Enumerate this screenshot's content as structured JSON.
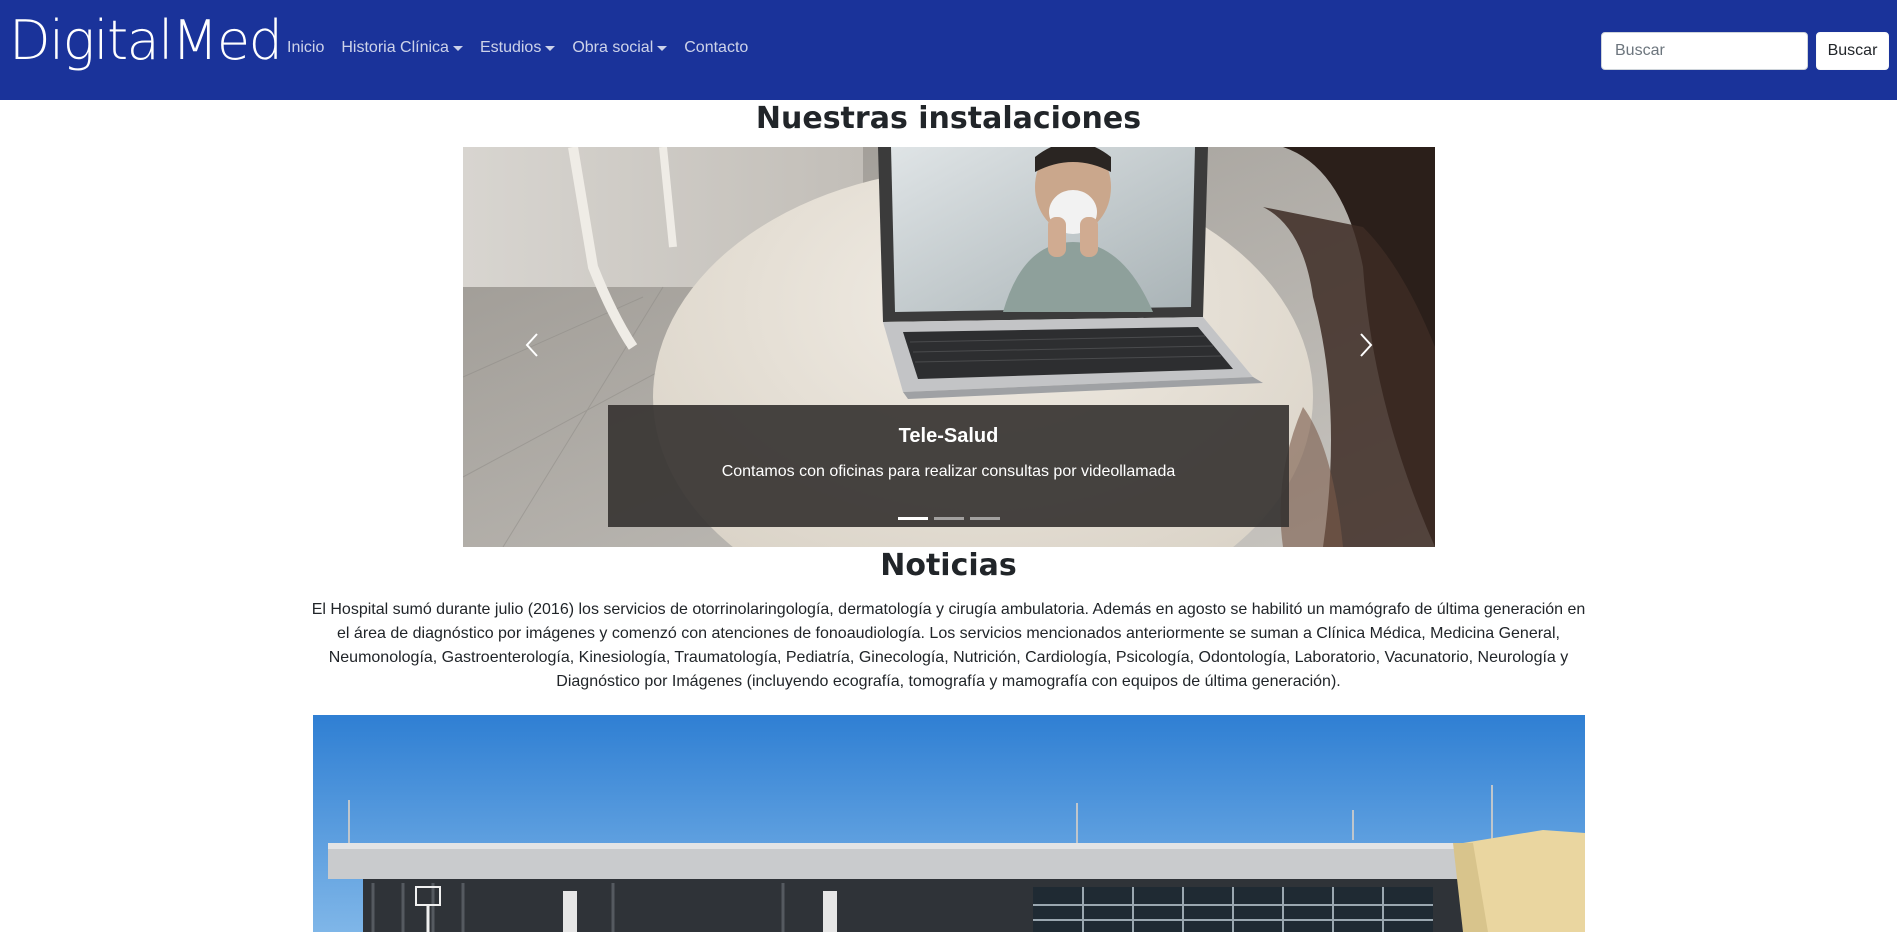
{
  "navbar": {
    "brand": "DigitalMed",
    "links": [
      {
        "label": "Inicio",
        "dropdown": false
      },
      {
        "label": "Historia Clínica",
        "dropdown": true
      },
      {
        "label": "Estudios",
        "dropdown": true
      },
      {
        "label": "Obra social",
        "dropdown": true
      },
      {
        "label": "Contacto",
        "dropdown": false
      }
    ],
    "search": {
      "placeholder": "Buscar",
      "value": ""
    },
    "search_button": "Buscar"
  },
  "facilities": {
    "title": "Nuestras instalaciones",
    "carousel": {
      "slide_title": "Tele-Salud",
      "slide_text": "Contamos con oficinas para realizar consultas por videollamada",
      "slide_count": 3,
      "active_index": 0
    }
  },
  "news": {
    "title": "Noticias",
    "body": "El Hospital sumó durante julio (2016) los servicios de otorrinolaringología, dermatología y cirugía ambulatoria. Además en agosto se habilitó un mamógrafo de última generación en el área de diagnóstico por imágenes y comenzó con atenciones de fonoaudiología. Los servicios mencionados anteriormente se suman a Clínica Médica, Medicina General, Neumonología, Gastroenterología, Kinesiología, Traumatología, Pediatría, Ginecología, Nutrición, Cardiología, Psicología, Odontología, Laboratorio, Vacunatorio, Neurología y Diagnóstico por Imágenes (incluyendo ecografía, tomografía y mamografía con equipos de última generación)."
  },
  "colors": {
    "navbar": "#1a339a",
    "caption_bg": "#373432",
    "sky": "#3a86d6"
  }
}
